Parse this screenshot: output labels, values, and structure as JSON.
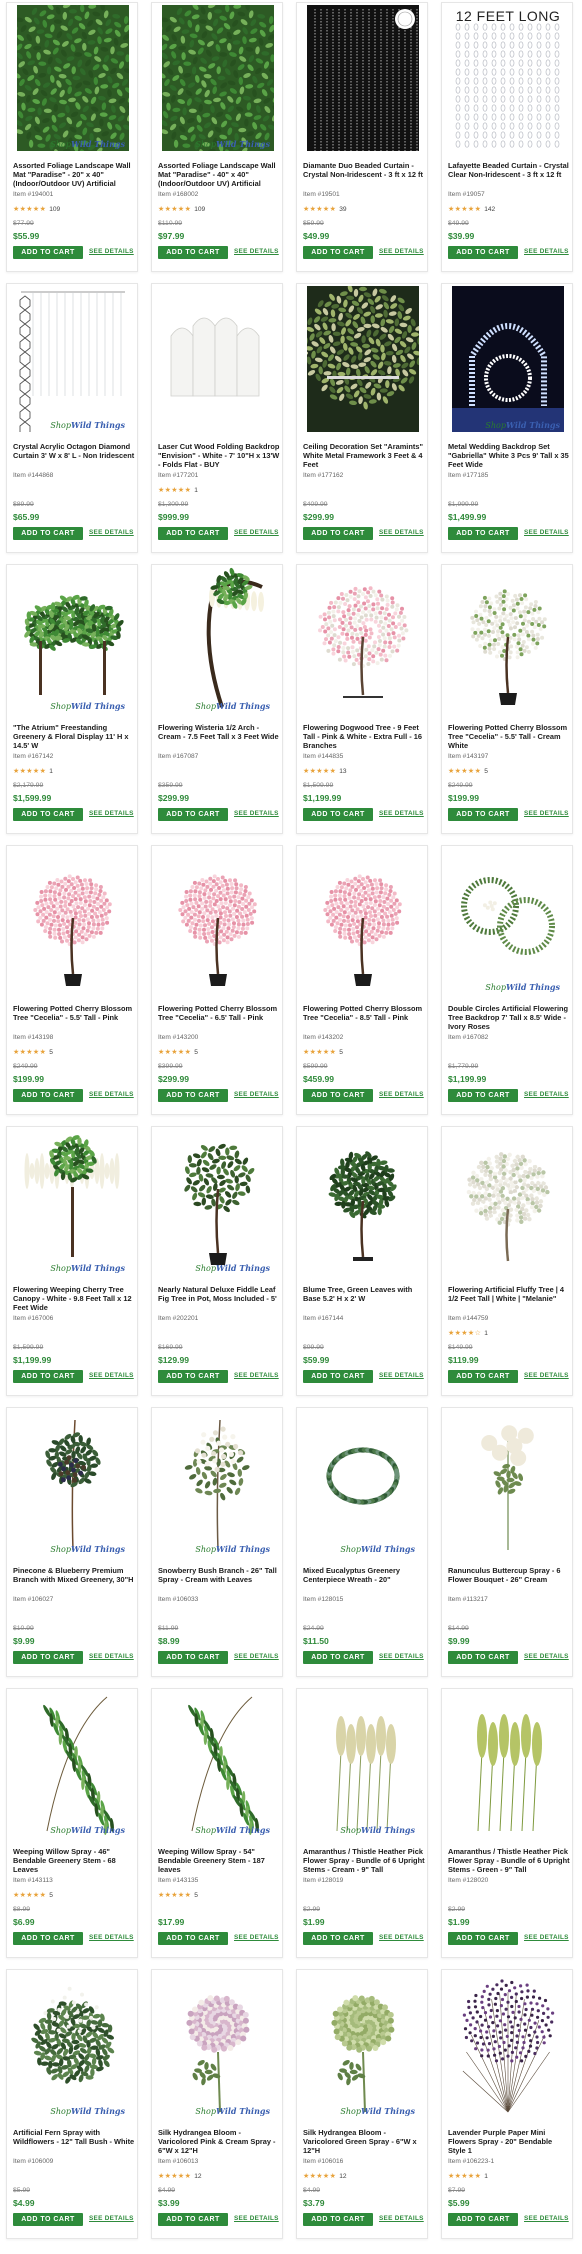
{
  "brand_watermark": {
    "shop": "Shop",
    "brand": "Wild Things"
  },
  "buttons": {
    "add_to_cart": "ADD TO CART",
    "see_details": "SEE DETAILS"
  },
  "colors": {
    "price_green": "#2f8a3a",
    "button_green": "#2e8b3b",
    "star_orange": "#e8a33c"
  },
  "products": [
    {
      "title": "Assorted Foliage Landscape Wall Mat \"Paradise\" - 20\" x 40\" (Indoor/Outdoor UV) Artificial",
      "item": "Item #194001",
      "stars": "★★★★★",
      "reviews": "109",
      "old_price": "$77.99",
      "price": "$55.99",
      "image": "greenery-mat",
      "watermark": true
    },
    {
      "title": "Assorted Foliage Landscape Wall Mat \"Paradise\" - 40\" x 40\" (Indoor/Outdoor UV) Artificial",
      "item": "Item #168002",
      "stars": "★★★★★",
      "reviews": "109",
      "old_price": "$110.99",
      "price": "$97.99",
      "image": "greenery-mat",
      "watermark": true
    },
    {
      "title": "Diamante Duo Beaded Curtain - Crystal Non-Iridescent - 3 ft x 12 ft",
      "item": "Item #19501",
      "stars": "★★★★★",
      "reviews": "39",
      "old_price": "$59.99",
      "price": "$49.99",
      "image": "bead-curtain-dark",
      "watermark": false
    },
    {
      "title": "Lafayette Beaded Curtain - Crystal Clear Non-Iridescent - 3 ft x 12 ft",
      "item": "Item #19057",
      "stars": "★★★★★",
      "reviews": "142",
      "old_price": "$49.99",
      "price": "$39.99",
      "image": "bead-curtain-light",
      "watermark": false,
      "image_text": "12 FEET LONG"
    },
    {
      "title": "Crystal Acrylic Octagon Diamond Curtain 3' W x 8' L - Non Iridescent",
      "item": "Item #144868",
      "stars": "",
      "reviews": "",
      "old_price": "$89.99",
      "price": "$65.99",
      "image": "octagon-curtain",
      "watermark": true
    },
    {
      "title": "Laser Cut Wood Folding Backdrop \"Envision\" - White - 7' 10\"H x 13'W - Folds Flat - BUY",
      "item": "Item #177201",
      "stars": "★★★★★",
      "reviews": "1",
      "old_price": "$1,309.99",
      "price": "$999.99",
      "image": "arch-backdrop",
      "watermark": false
    },
    {
      "title": "Ceiling Decoration Set \"Aramints\" White Metal Framework 3 Feet & 4 Feet",
      "item": "Item #177162",
      "stars": "",
      "reviews": "",
      "old_price": "$409.99",
      "price": "$299.99",
      "image": "ceiling-decor",
      "watermark": false
    },
    {
      "title": "Metal Wedding Backdrop Set \"Gabriella\" White 3 Pcs 9' Tall x 35 Feet Wide",
      "item": "Item #177185",
      "stars": "",
      "reviews": "",
      "old_price": "$1,999.99",
      "price": "$1,499.99",
      "image": "wedding-backdrop",
      "watermark": true
    },
    {
      "title": "\"The Atrium\" Freestanding Greenery & Floral Display 11' H x 14.5' W",
      "item": "Item #167142",
      "stars": "★★★★★",
      "reviews": "1",
      "old_price": "$2,179.99",
      "price": "$1,599.99",
      "image": "atrium-display",
      "watermark": true
    },
    {
      "title": "Flowering Wisteria 1/2 Arch - Cream - 7.5 Feet Tall x 3 Feet Wide",
      "item": "Item #167087",
      "stars": "",
      "reviews": "",
      "old_price": "$359.99",
      "price": "$299.99",
      "image": "wisteria-arch",
      "watermark": true
    },
    {
      "title": "Flowering Dogwood Tree - 9 Feet Tall - Pink & White - Extra Full - 16 Branches",
      "item": "Item #144835",
      "stars": "★★★★★",
      "reviews": "13",
      "old_price": "$1,509.99",
      "price": "$1,199.99",
      "image": "dogwood-tree",
      "watermark": false
    },
    {
      "title": "Flowering Potted Cherry Blossom Tree \"Cecelia\" - 5.5' Tall - Cream White",
      "item": "Item #143197",
      "stars": "★★★★★",
      "reviews": "5",
      "old_price": "$249.99",
      "price": "$199.99",
      "image": "cherry-white",
      "watermark": false
    },
    {
      "title": "Flowering Potted Cherry Blossom Tree \"Cecelia\" - 5.5' Tall - Pink",
      "item": "Item #143198",
      "stars": "★★★★★",
      "reviews": "5",
      "old_price": "$249.99",
      "price": "$199.99",
      "image": "cherry-pink",
      "watermark": false
    },
    {
      "title": "Flowering Potted Cherry Blossom Tree \"Cecelia\" - 6.5' Tall - Pink",
      "item": "Item #143200",
      "stars": "★★★★★",
      "reviews": "5",
      "old_price": "$399.99",
      "price": "$299.99",
      "image": "cherry-pink",
      "watermark": false
    },
    {
      "title": "Flowering Potted Cherry Blossom Tree \"Cecelia\" - 8.5' Tall - Pink",
      "item": "Item #143202",
      "stars": "★★★★★",
      "reviews": "5",
      "old_price": "$599.99",
      "price": "$459.99",
      "image": "cherry-pink",
      "watermark": false
    },
    {
      "title": "Double Circles Artificial Flowering Tree Backdrop 7' Tall x 8.5' Wide - Ivory Roses",
      "item": "Item #167082",
      "stars": "",
      "reviews": "",
      "old_price": "$1,779.99",
      "price": "$1,199.99",
      "image": "double-circles",
      "watermark": true
    },
    {
      "title": "Flowering Weeping Cherry Tree Canopy - White - 9.8 Feet Tall x 12 Feet Wide",
      "item": "Item #167006",
      "stars": "",
      "reviews": "",
      "old_price": "$1,599.99",
      "price": "$1,199.99",
      "image": "weeping-canopy",
      "watermark": true
    },
    {
      "title": "Nearly Natural Deluxe Fiddle Leaf Fig Tree in Pot, Moss Included - 5'",
      "item": "Item #202201",
      "stars": "",
      "reviews": "",
      "old_price": "$169.99",
      "price": "$129.99",
      "image": "fiddle-fig",
      "watermark": true
    },
    {
      "title": "Blume Tree, Green Leaves with Base 5.2' H x 2' W",
      "item": "Item #167144",
      "stars": "",
      "reviews": "",
      "old_price": "$99.99",
      "price": "$59.99",
      "image": "blume-tree",
      "watermark": false
    },
    {
      "title": "Flowering Artificial Fluffy Tree | 4 1/2 Feet Tall | White | \"Melanie\"",
      "item": "Item #144759",
      "stars": "★★★★☆",
      "reviews": "1",
      "old_price": "$149.99",
      "price": "$119.99",
      "image": "fluffy-tree",
      "watermark": false
    },
    {
      "title": "Pinecone & Blueberry Premium Branch with Mixed Greenery, 30\"H",
      "item": "Item #106027",
      "stars": "",
      "reviews": "",
      "old_price": "$10.99",
      "price": "$9.99",
      "image": "pinecone-branch",
      "watermark": true
    },
    {
      "title": "Snowberry Bush Branch - 26\" Tall Spray - Cream with Leaves",
      "item": "Item #106033",
      "stars": "",
      "reviews": "",
      "old_price": "$11.99",
      "price": "$8.99",
      "image": "snowberry",
      "watermark": true
    },
    {
      "title": "Mixed Eucalyptus Greenery Centerpiece Wreath - 20\"",
      "item": "Item #128015",
      "stars": "",
      "reviews": "",
      "old_price": "$24.99",
      "price": "$11.50",
      "image": "eucalyptus-wreath",
      "watermark": true
    },
    {
      "title": "Ranunculus Buttercup Spray - 6 Flower Bouquet - 26\" Cream",
      "item": "Item #113217",
      "stars": "",
      "reviews": "",
      "old_price": "$14.99",
      "price": "$9.99",
      "image": "ranunculus",
      "watermark": false
    },
    {
      "title": "Weeping Willow Spray - 46\" Bendable Greenery Stem - 68 Leaves",
      "item": "Item #143113",
      "stars": "★★★★★",
      "reviews": "5",
      "old_price": "$8.99",
      "price": "$6.99",
      "image": "willow-spray",
      "watermark": true
    },
    {
      "title": "Weeping Willow Spray - 54\" Bendable Greenery Stem - 187 leaves",
      "item": "Item #143135",
      "stars": "★★★★★",
      "reviews": "5",
      "old_price": "",
      "price": "$17.99",
      "image": "willow-spray",
      "watermark": true
    },
    {
      "title": "Amaranthus / Thistle Heather Pick Flower Spray - Bundle of 6 Upright Stems - Cream - 9\" Tall",
      "item": "Item #128019",
      "stars": "",
      "reviews": "",
      "old_price": "$2.99",
      "price": "$1.99",
      "image": "amaranthus-cream",
      "watermark": true
    },
    {
      "title": "Amaranthus / Thistle Heather Pick Flower Spray - Bundle of 6 Upright Stems - Green - 9\" Tall",
      "item": "Item #128020",
      "stars": "",
      "reviews": "",
      "old_price": "$2.99",
      "price": "$1.99",
      "image": "amaranthus-green",
      "watermark": false
    },
    {
      "title": "Artificial Fern Spray with Wildflowers - 12\" Tall Bush - White",
      "item": "Item #106009",
      "stars": "",
      "reviews": "",
      "old_price": "$5.99",
      "price": "$4.99",
      "image": "fern-spray",
      "watermark": true
    },
    {
      "title": "Silk Hydrangea Bloom - Varicolored Pink & Cream Spray - 6\"W x 12\"H",
      "item": "Item #106013",
      "stars": "★★★★★",
      "reviews": "12",
      "old_price": "$4.99",
      "price": "$3.99",
      "image": "hydrangea-pink",
      "watermark": true
    },
    {
      "title": "Silk Hydrangea Bloom - Varicolored Green Spray - 6\"W x 12\"H",
      "item": "Item #106016",
      "stars": "★★★★★",
      "reviews": "12",
      "old_price": "$4.99",
      "price": "$3.79",
      "image": "hydrangea-green",
      "watermark": true
    },
    {
      "title": "Lavender Purple Paper Mini Flowers Spray - 20\" Bendable Style 1",
      "item": "Item #106223-1",
      "stars": "★★★★★",
      "reviews": "1",
      "old_price": "$7.99",
      "price": "$5.99",
      "image": "lavender-spray",
      "watermark": false
    }
  ]
}
